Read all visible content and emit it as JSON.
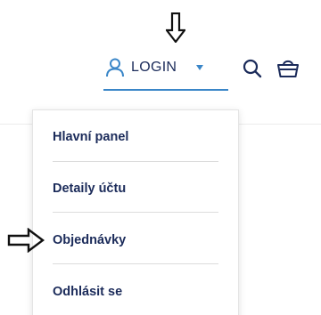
{
  "header": {
    "login_label": "LOGIN"
  },
  "menu": {
    "items": [
      {
        "label": "Hlavní panel"
      },
      {
        "label": "Detaily účtu"
      },
      {
        "label": "Objednávky"
      },
      {
        "label": "Odhlásit se"
      }
    ]
  },
  "colors": {
    "brand_navy": "#1b2b5a",
    "accent_blue": "#3a86c8"
  },
  "icons": {
    "user": "user-icon",
    "dropdown": "caret-down-icon",
    "search": "search-icon",
    "basket": "basket-icon",
    "annotation_down": "down-arrow-icon",
    "annotation_right": "right-arrow-icon"
  }
}
